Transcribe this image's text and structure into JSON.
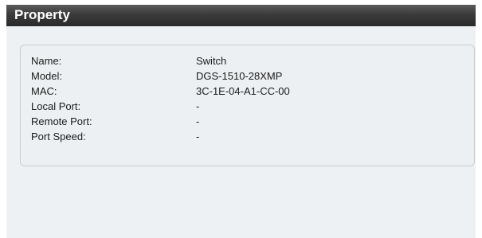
{
  "panel": {
    "title": "Property"
  },
  "properties": [
    {
      "label": "Name:",
      "value": "Switch"
    },
    {
      "label": "Model:",
      "value": "DGS-1510-28XMP"
    },
    {
      "label": "MAC:",
      "value": "3C-1E-04-A1-CC-00"
    },
    {
      "label": "Local Port:",
      "value": "-"
    },
    {
      "label": "Remote Port:",
      "value": "-"
    },
    {
      "label": "Port Speed:",
      "value": "-"
    }
  ]
}
